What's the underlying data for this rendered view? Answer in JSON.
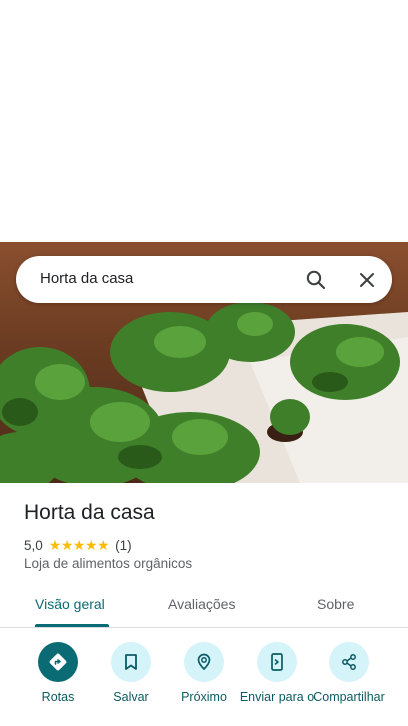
{
  "search": {
    "query": "Horta da casa"
  },
  "place": {
    "title": "Horta da casa",
    "rating": "5,0",
    "stars": [
      "★",
      "★",
      "★",
      "★",
      "★"
    ],
    "review_count": "(1)",
    "category": "Loja de alimentos orgânicos",
    "photo_description": "garden photo"
  },
  "tabs": [
    {
      "label": "Visão geral",
      "active": true
    },
    {
      "label": "Avaliações",
      "active": false
    },
    {
      "label": "Sobre",
      "active": false
    }
  ],
  "actions": [
    {
      "label": "Rotas",
      "icon": "directions-icon"
    },
    {
      "label": "Salvar",
      "icon": "bookmark-icon"
    },
    {
      "label": "Próximo",
      "icon": "nearby-icon"
    },
    {
      "label": "Enviar para o",
      "icon": "send-to-phone-icon"
    },
    {
      "label": "Compartilhar",
      "icon": "share-icon"
    }
  ],
  "colors": {
    "accent": "#0b6b74",
    "action_bg": "#d4f4fa",
    "star": "#fbbc04"
  }
}
